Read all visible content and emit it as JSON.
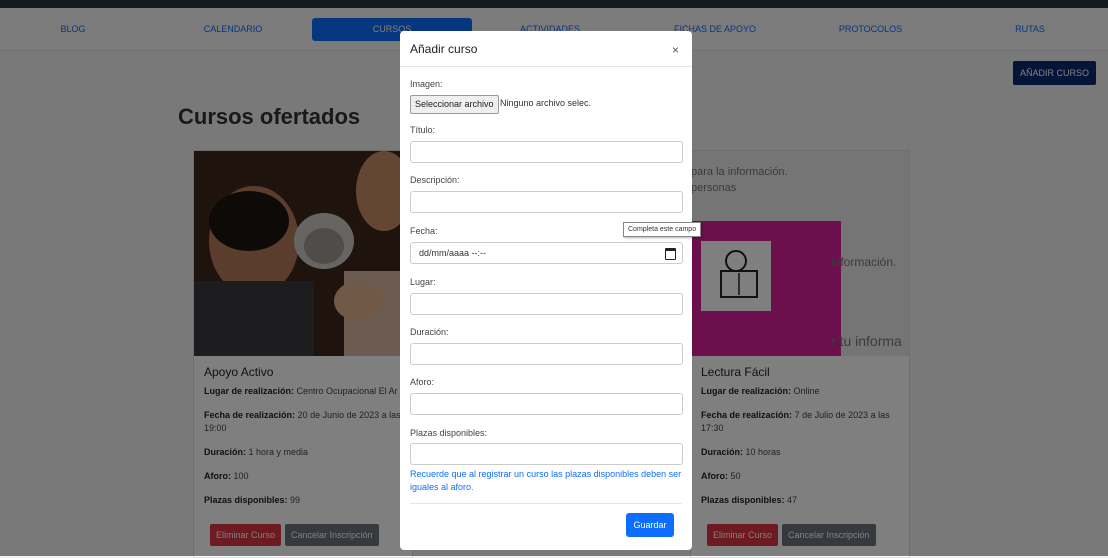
{
  "nav": {
    "items": [
      "BLOG",
      "CALENDARIO",
      "CURSOS",
      "ACTIVIDADES",
      "FICHAS DE APOYO",
      "PROTOCOLOS",
      "RUTAS"
    ],
    "active": "CURSOS"
  },
  "add_course_label": "AÑADIR CURSO",
  "page_title": "Cursos ofertados",
  "cards": [
    {
      "title": "Apoyo Activo",
      "lugar_label": "Lugar de realización:",
      "lugar": "Centro Ocupacional El Ar",
      "fecha_label": "Fecha de realización:",
      "fecha": "20 de Junio de 2023 a las 19:00",
      "duracion_label": "Duración:",
      "duracion": "1 hora y media",
      "aforo_label": "Aforo:",
      "aforo": "100",
      "plazas_label": "Plazas disponibles:",
      "plazas": "99",
      "delete_label": "Eliminar Curso",
      "cancel_label": "Cancelar Inscripción"
    },
    {
      "title": "Lectura Fácil",
      "lugar_label": "Lugar de realización:",
      "lugar": "Online",
      "fecha_label": "Fecha de realización:",
      "fecha": "7 de Julio de 2023 a las 17:30",
      "duracion_label": "Duración:",
      "duracion": "10 horas",
      "aforo_label": "Aforo:",
      "aforo": "50",
      "plazas_label": "Plazas disponibles:",
      "plazas": "47",
      "delete_label": "Eliminar Curso",
      "cancel_label": "Cancelar Inscripción",
      "image_texts": [
        "para la información.",
        "personas",
        "información.",
        "r tu informa"
      ]
    }
  ],
  "modal": {
    "title": "Añadir curso",
    "close": "×",
    "imagen_label": "Imagen:",
    "file_button": "Seleccionar archivo",
    "file_status": "Ninguno archivo selec.",
    "titulo_label": "Título:",
    "descripcion_label": "Descripción:",
    "fecha_label": "Fecha:",
    "fecha_placeholder": "dd/mm/aaaa --:--",
    "lugar_label": "Lugar:",
    "duracion_label": "Duración:",
    "aforo_label": "Aforo:",
    "plazas_label": "Plazas disponibles:",
    "note": "Recuerde que al registrar un curso las plazas disponibles deben ser iguales al aforo.",
    "save_label": "Guardar"
  },
  "tooltip": "Completa este campo"
}
